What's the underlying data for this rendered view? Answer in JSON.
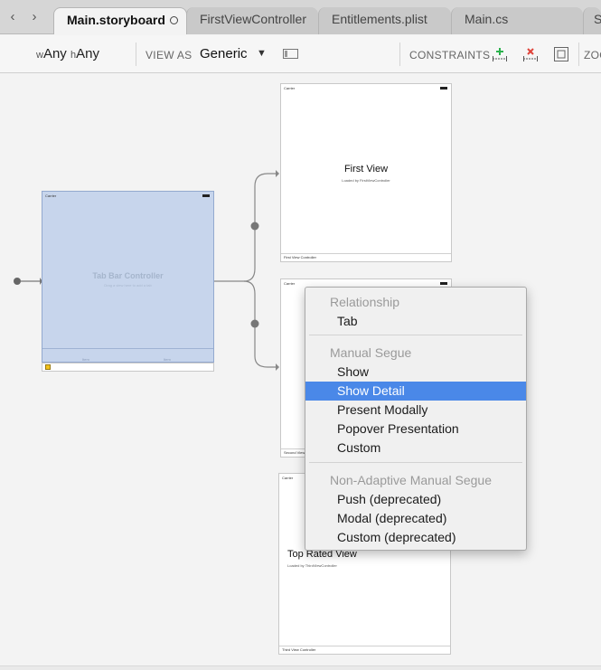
{
  "tabs": [
    {
      "label": "Main.storyboard",
      "active": true
    },
    {
      "label": "FirstViewController",
      "active": false
    },
    {
      "label": "Entitlements.plist",
      "active": false
    },
    {
      "label": "Main.cs",
      "active": false
    },
    {
      "label": "S",
      "active": false
    }
  ],
  "toolbar": {
    "size_w_prefix": "w",
    "size_w": "Any",
    "size_h_prefix": "h",
    "size_h": "Any",
    "view_as_label": "VIEW AS",
    "view_as_value": "Generic",
    "constraints_label": "CONSTRAINTS",
    "zoom_label": "ZOO"
  },
  "canvas": {
    "tab_bar_controller": {
      "carrier": "Carrier",
      "title": "Tab Bar Controller",
      "subtitle": "Drag a view here to add a tab",
      "tab_labels": [
        "Item",
        "Item"
      ]
    },
    "first_scene": {
      "carrier": "Carrier",
      "title": "First View",
      "subtitle": "Loaded by FirstViewController",
      "footer": "First View Controller"
    },
    "second_scene": {
      "carrier": "Carrier",
      "footer": "Second View"
    },
    "third_scene": {
      "carrier": "Carrier",
      "title": "Top Rated View",
      "subtitle": "Loaded by ThirdViewController",
      "footer": "Third View Controller"
    }
  },
  "context_menu": {
    "sections": [
      {
        "header": "Relationship",
        "items": [
          "Tab"
        ]
      },
      {
        "header": "Manual Segue",
        "items": [
          "Show",
          "Show Detail",
          "Present Modally",
          "Popover Presentation",
          "Custom"
        ]
      },
      {
        "header": "Non-Adaptive Manual Segue",
        "items": [
          "Push (deprecated)",
          "Modal (deprecated)",
          "Custom (deprecated)"
        ]
      }
    ],
    "highlighted_item": "Show Detail"
  },
  "colors": {
    "accent": "#4a88e8",
    "tab_bar_controller_fill": "#c7d5ec",
    "add_constraint": "#2bb24c",
    "remove_constraint": "#e0443b"
  },
  "icons": [
    "chevron-left-icon",
    "chevron-right-icon",
    "unsaved-dot-icon",
    "device-frame-icon",
    "add-constraint-icon",
    "remove-constraint-icon",
    "resolve-constraints-icon"
  ]
}
